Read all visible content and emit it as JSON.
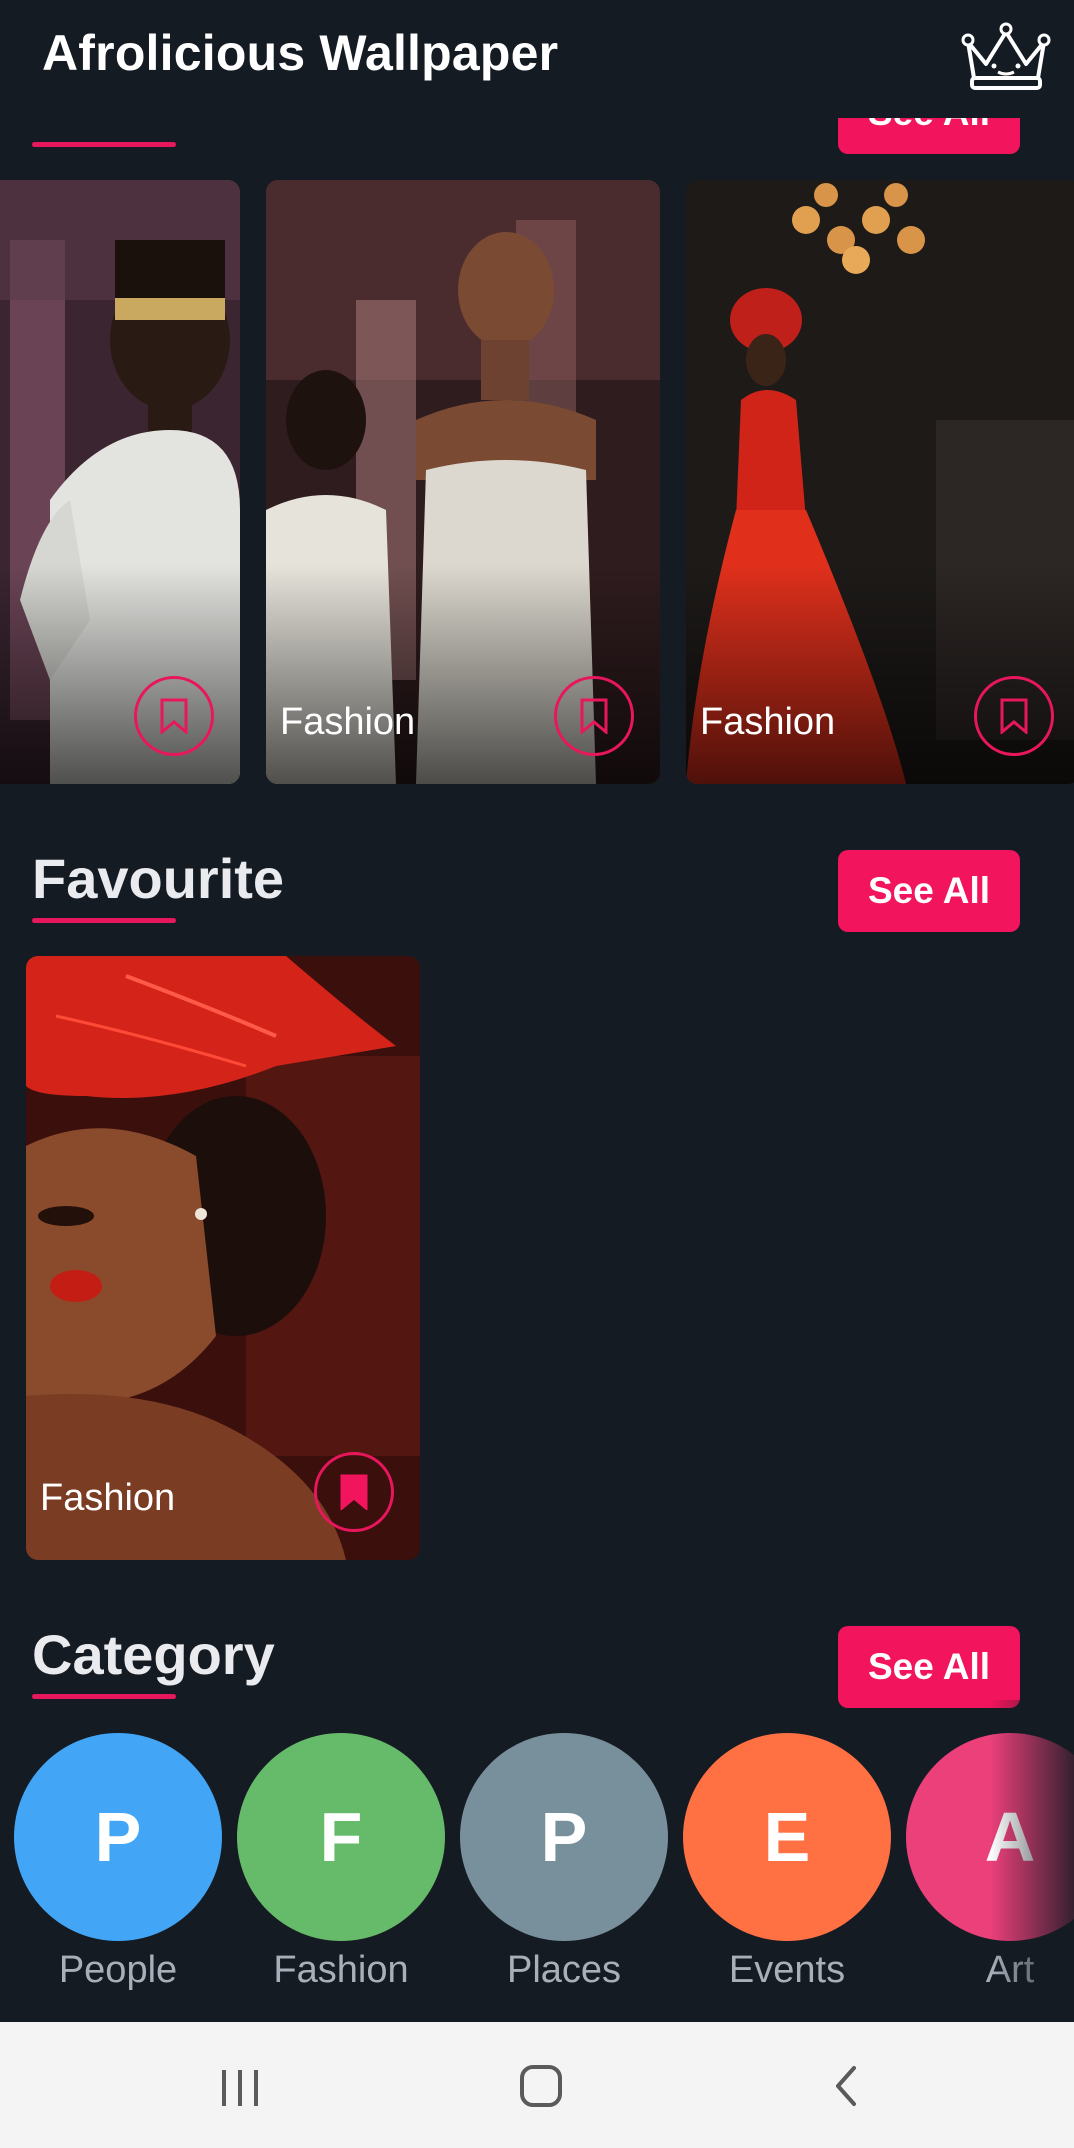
{
  "app": {
    "title": "Afrolicious Wallpaper"
  },
  "top_section": {
    "see_all": "See All",
    "cards": [
      {
        "label": ""
      },
      {
        "label": "Fashion"
      },
      {
        "label": "Fashion"
      }
    ]
  },
  "favourite": {
    "title": "Favourite",
    "see_all": "See All",
    "cards": [
      {
        "label": "Fashion",
        "bookmarked": true
      }
    ]
  },
  "category": {
    "title": "Category",
    "see_all": "See All",
    "items": [
      {
        "letter": "P",
        "label": "People",
        "color": "#42a5f5"
      },
      {
        "letter": "F",
        "label": "Fashion",
        "color": "#66bb6a"
      },
      {
        "letter": "P",
        "label": "Places",
        "color": "#78909c"
      },
      {
        "letter": "E",
        "label": "Events",
        "color": "#ff7043"
      },
      {
        "letter": "A",
        "label": "Art",
        "color": "#ec407a"
      }
    ]
  },
  "colors": {
    "accent": "#f2145c",
    "background": "#151b23",
    "nav_bar": "#f4f4f4"
  },
  "icons": [
    "crown-icon",
    "bookmark-icon",
    "recent-apps-icon",
    "home-icon",
    "back-icon"
  ]
}
